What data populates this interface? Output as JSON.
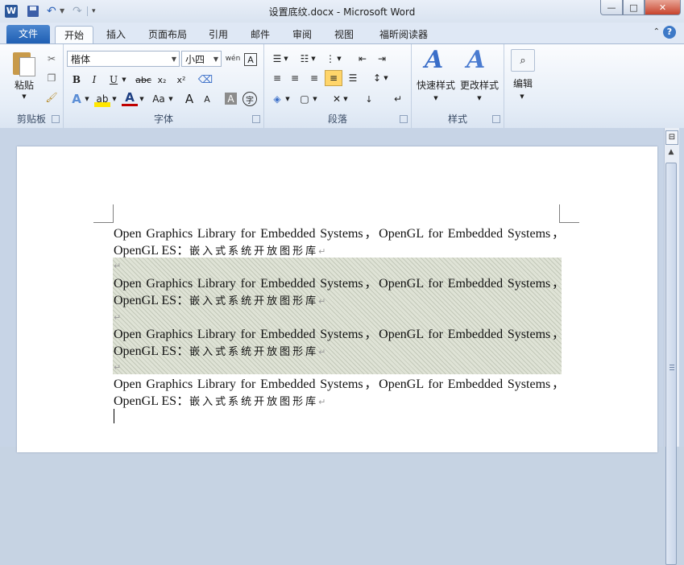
{
  "window": {
    "title": "设置底纹.docx  -  Microsoft Word",
    "app_icon": "W",
    "quick_access": [
      "save-icon",
      "undo-icon",
      "redo-icon",
      "customize-icon"
    ],
    "buttons": {
      "minimize": "—",
      "maximize": "□",
      "close": "✕"
    }
  },
  "tabs": {
    "file": "文件",
    "items": [
      "开始",
      "插入",
      "页面布局",
      "引用",
      "邮件",
      "审阅",
      "视图",
      "福昕阅读器"
    ],
    "active": "开始",
    "collapse": "⌃",
    "help": "?"
  },
  "ribbon": {
    "clipboard": {
      "label": "剪贴板",
      "paste": "粘贴"
    },
    "font": {
      "label": "字体",
      "font_name": "楷体",
      "font_size": "小四",
      "phonetic_icon": "wén",
      "char_border": "A",
      "bold": "B",
      "italic": "I",
      "underline": "U",
      "strikethrough": "abc",
      "subscript": "x₂",
      "superscript": "x²",
      "font_color": "A",
      "change_case": "Aa",
      "grow": "A",
      "shrink": "A",
      "char_shading": "A",
      "enclose": "字"
    },
    "paragraph": {
      "label": "段落"
    },
    "styles": {
      "label": "样式",
      "quick_styles": "快速样式",
      "change_styles": "更改样式"
    },
    "editing": {
      "label": "编辑"
    }
  },
  "document": {
    "paragraphs": [
      {
        "line1": "Open Graphics Library for Embedded Systems，OpenGL for Embedded Systems，",
        "line2_latin": "OpenGL ES：",
        "line2_cjk": "嵌入式系统开放图形库",
        "shaded": false
      },
      {
        "line1": "Open Graphics Library for Embedded Systems，OpenGL for Embedded Systems，",
        "line2_latin": "OpenGL ES：",
        "line2_cjk": "嵌入式系统开放图形库",
        "shaded": true
      },
      {
        "line1": "Open Graphics Library for Embedded Systems，OpenGL for Embedded Systems，",
        "line2_latin": "OpenGL ES：",
        "line2_cjk": "嵌入式系统开放图形库",
        "shaded": true
      },
      {
        "line1": "Open Graphics Library for Embedded Systems，OpenGL for Embedded Systems，",
        "line2_latin": "OpenGL ES：",
        "line2_cjk": "嵌入式系统开放图形库",
        "shaded": false
      }
    ],
    "paragraph_mark": "↵"
  },
  "colors": {
    "file_tab": "#2b68bf",
    "shading": "#dfe3d6",
    "accent": "#3a6ec8",
    "highlight": "#ffe600",
    "font_color": "#c00000"
  }
}
